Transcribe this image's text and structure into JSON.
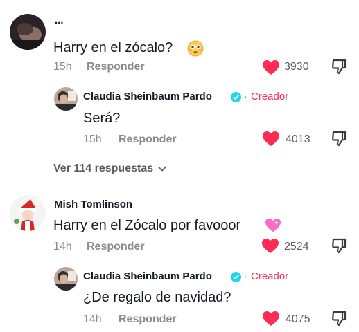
{
  "comments": [
    {
      "username": "...",
      "text": "Harry en el zócalo?",
      "emoji": "flushed-face",
      "time": "15h",
      "reply_label": "Responder",
      "likes": "3930",
      "reply": {
        "username": "Claudia Sheinbaum Pardo",
        "badge": "Creador",
        "text": "Será?",
        "time": "15h",
        "reply_label": "Responder",
        "likes": "4013"
      },
      "more_replies": "Ver 114 respuestas"
    },
    {
      "username": "Mish Tomlinson",
      "text": "Harry en el Zócalo por favooor",
      "emoji": "pink-heart",
      "time": "14h",
      "reply_label": "Responder",
      "likes": "2524",
      "reply": {
        "username": "Claudia Sheinbaum Pardo",
        "badge": "Creador",
        "text": "¿De regalo de navidad?",
        "time": "14h",
        "reply_label": "Responder",
        "likes": "4075"
      }
    }
  ],
  "colors": {
    "heart": "#fe2c55",
    "creator": "#fe2c55",
    "verified": "#20d5ec",
    "muted": "#8a8b91"
  }
}
